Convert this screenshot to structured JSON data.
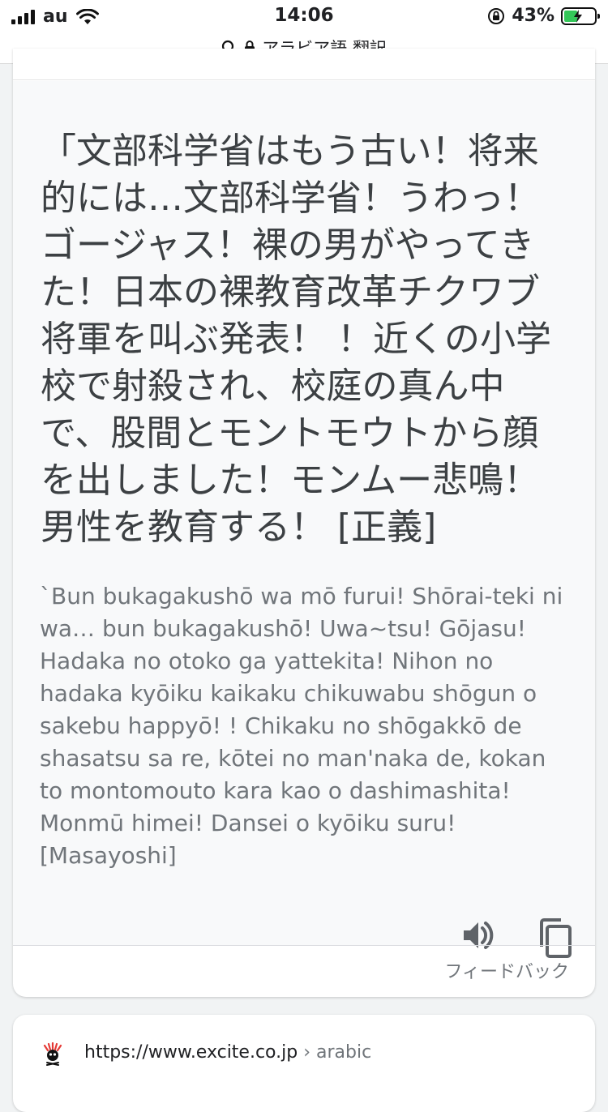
{
  "status": {
    "carrier": "au",
    "time": "14:06",
    "battery_percent": "43%"
  },
  "address": {
    "text": "アラビア語 翻訳"
  },
  "translation": {
    "text": "「文部科学省はもう古い！将来的には…文部科学省！うわっ！ゴージャス！裸の男がやってきた！日本の裸教育改革チクワブ将軍を叫ぶ発表！ ！近くの小学校で射殺され、校庭の真ん中で、股間とモントモウトから顔を出しました！モンムー悲鳴！男性を教育する！ [正義]",
    "romanization": "`Bun bukagakushō wa mō furui! Shōrai-teki ni wa… bun bukagakushō! Uwa~tsu! Gōjasu! Hadaka no otoko ga yattekita! Nihon no hadaka kyōiku kaikaku chikuwabu shōgun o sakebu happyō! ! Chikaku no shōgakkō de shasatsu sa re, kōtei no man'naka de, kokan to montomouto kara kao o dashimashita! Monmū himei! Dansei o kyōiku suru! [Masayoshi]",
    "feedback_label": "フィードバック"
  },
  "result": {
    "url": "https://www.excite.co.jp",
    "separator": " › ",
    "path": "arabic"
  },
  "colors": {
    "battery_fill": "#34c759",
    "secondary_text": "#70757a",
    "icon_gray": "#5f6368"
  }
}
